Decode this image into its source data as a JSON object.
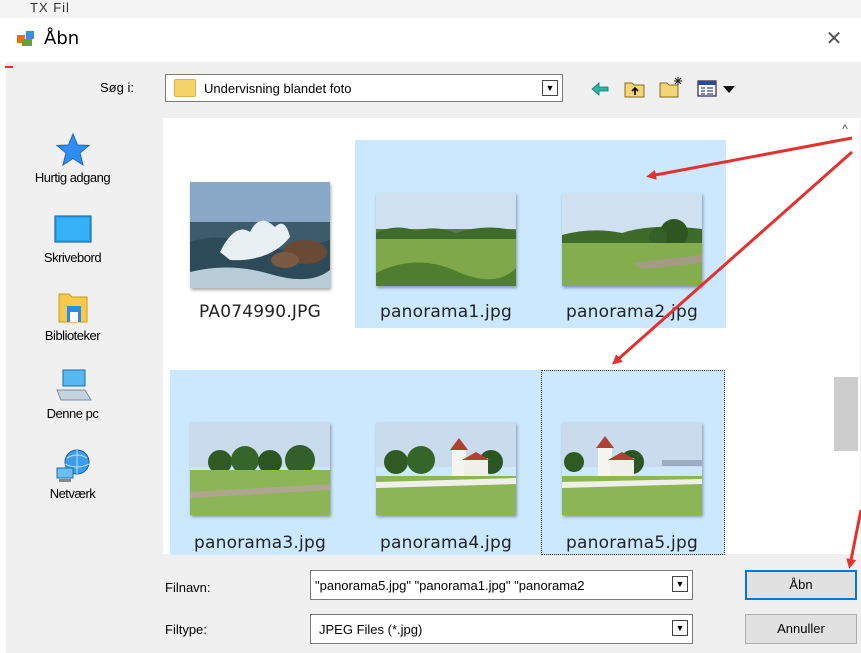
{
  "background_window": {
    "text": "TX Fil"
  },
  "title": {
    "text": "Åbn",
    "close_glyph": "✕"
  },
  "look_in": {
    "label": "Søg i:",
    "value": "Undervisning blandet foto"
  },
  "toolbar": {
    "back_icon": "back-arrow-icon",
    "up_icon": "up-folder-icon",
    "new_folder_icon": "new-folder-icon",
    "view_menu_icon": "view-menu-icon"
  },
  "places": [
    {
      "label": "Hurtig adgang",
      "icon": "star-icon"
    },
    {
      "label": "Skrivebord",
      "icon": "desktop-icon"
    },
    {
      "label": "Biblioteker",
      "icon": "library-icon"
    },
    {
      "label": "Denne pc",
      "icon": "computer-icon"
    },
    {
      "label": "Netværk",
      "icon": "network-icon"
    }
  ],
  "files": [
    {
      "name": "PA074990.JPG",
      "selected": false
    },
    {
      "name": "panorama1.jpg",
      "selected": true
    },
    {
      "name": "panorama2.jpg",
      "selected": true
    },
    {
      "name": "panorama3.jpg",
      "selected": true
    },
    {
      "name": "panorama4.jpg",
      "selected": true
    },
    {
      "name": "panorama5.jpg",
      "selected": true,
      "focused": true
    }
  ],
  "filename": {
    "label": "Filnavn:",
    "value": "\"panorama5.jpg\" \"panorama1.jpg\" \"panorama2"
  },
  "filetype": {
    "label": "Filtype:",
    "value": "JPEG Files (*.jpg)"
  },
  "buttons": {
    "open": "Åbn",
    "cancel": "Annuller"
  },
  "colors": {
    "selection": "#cce8ff",
    "accent": "#0078d7",
    "arrow": "#e53030"
  }
}
